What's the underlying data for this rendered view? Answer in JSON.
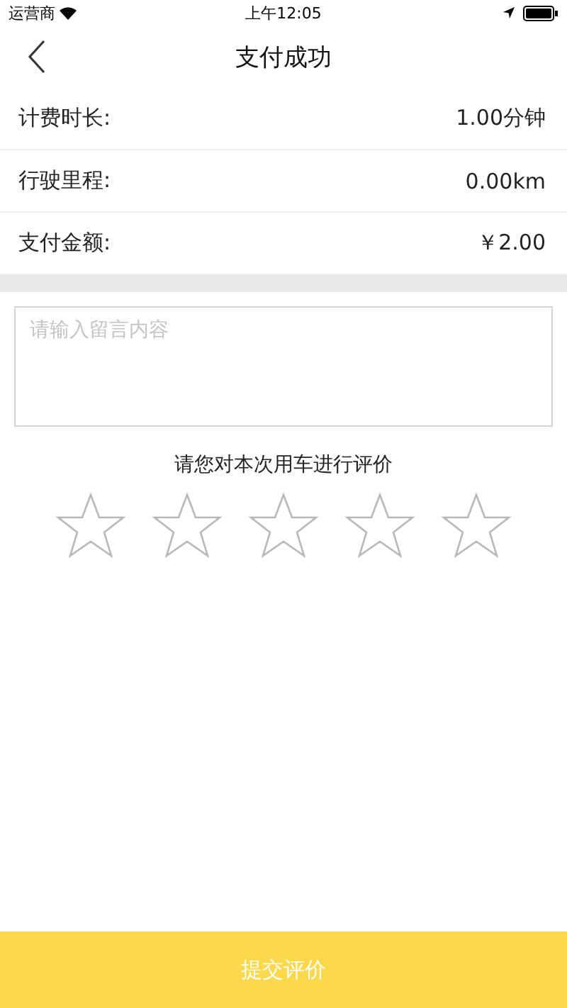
{
  "status_bar": {
    "carrier": "运营商",
    "time": "上午12:05"
  },
  "nav_bar": {
    "title": "支付成功"
  },
  "details": [
    {
      "label": "计费时长:",
      "value": "1.00分钟"
    },
    {
      "label": "行驶里程:",
      "value": "0.00km"
    },
    {
      "label": "支付金额:",
      "value": "￥2.00"
    }
  ],
  "comment": {
    "placeholder": "请输入留言内容"
  },
  "rating": {
    "prompt": "请您对本次用车进行评价",
    "stars": 0
  },
  "submit_button": {
    "label": "提交评价"
  }
}
